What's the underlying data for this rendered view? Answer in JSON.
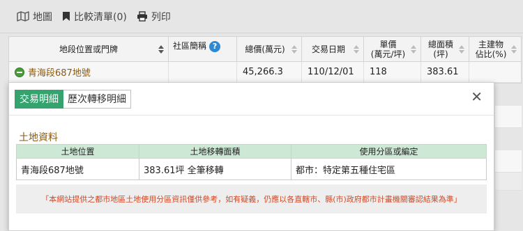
{
  "toolbar": {
    "map_label": "地圖",
    "compare_label": "比較清單(0)",
    "print_label": "列印"
  },
  "grid": {
    "headers": {
      "address": "地段位置或門牌",
      "community": "社區簡稱",
      "total_price": "總價(萬元)",
      "date": "交易日期",
      "unit_price_line1": "單價",
      "unit_price_line2": "(萬元/坪)",
      "area_line1": "總面積",
      "area_line2": "(坪)",
      "main_ratio_line1": "主建物",
      "main_ratio_line2": "佔比(%)"
    },
    "row": {
      "address": "青海段687地號",
      "community": "",
      "total_price": "45,266.3",
      "date": "110/12/01",
      "unit_price": "118",
      "area": "383.61",
      "main_ratio": ""
    }
  },
  "popup": {
    "tabs": [
      "交易明細",
      "歷次轉移明細"
    ],
    "active_tab": "交易明細",
    "close_glyph": "✕",
    "section_title": "土地資料",
    "table": {
      "headers": [
        "土地位置",
        "土地移轉面積",
        "使用分區或編定"
      ],
      "rows": [
        [
          "青海段687地號",
          "383.61坪 全筆移轉",
          "都市：特定第五種住宅區"
        ]
      ]
    },
    "notice": "「本網站提供之都市地區土地使用分區資訊僅供參考，如有疑義，仍應以各直轄市、縣(市)政府都市計畫機關審認結果為準」"
  },
  "colors": {
    "tab_active": "#34a36e",
    "table_header": "#cde8d5",
    "section_title": "#8a5a12",
    "notice_text": "#d24a28",
    "help_icon": "#2e88d2",
    "row_icon": "#4c9a39"
  },
  "icons": {
    "map": "map-icon",
    "compare": "bookmark-icon",
    "print": "printer-icon",
    "help": "help-circle-icon",
    "collapse": "minus-circle-icon",
    "close": "close-icon"
  }
}
